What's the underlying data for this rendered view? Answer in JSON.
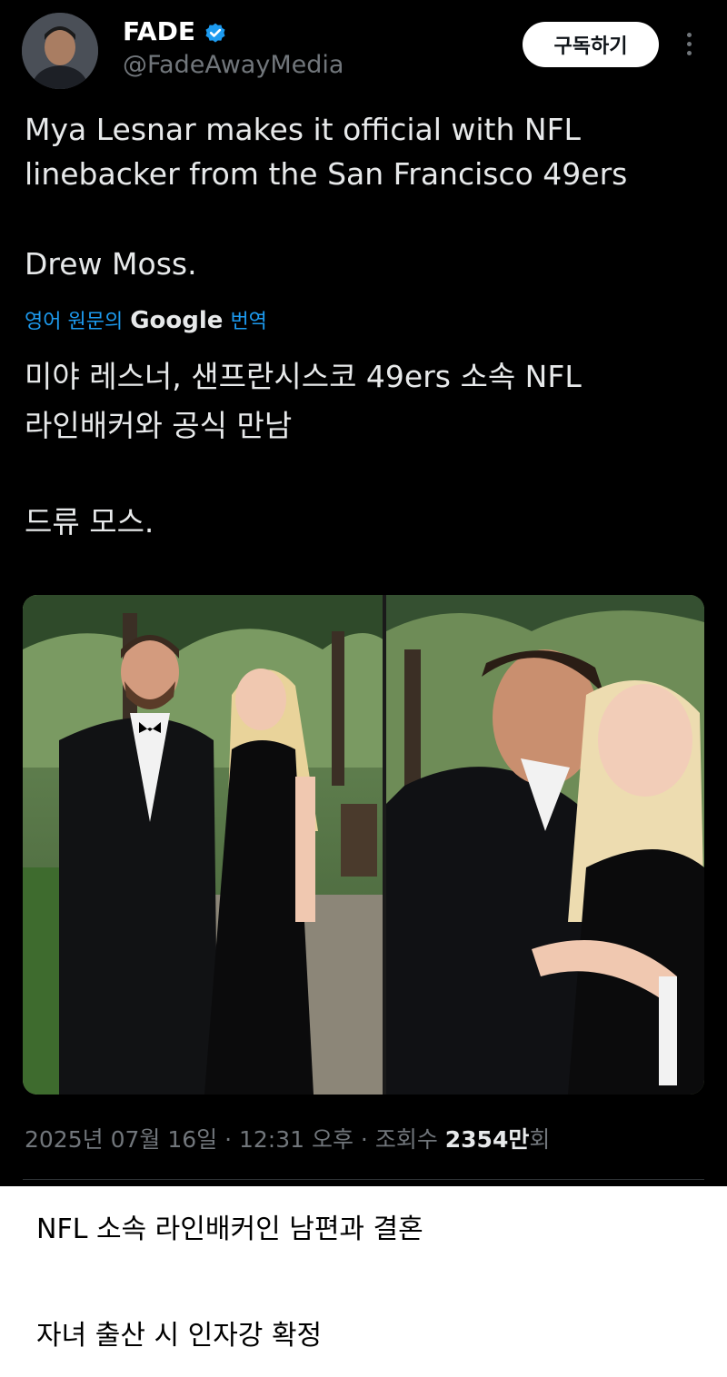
{
  "tweet": {
    "author_name": "FADE",
    "handle": "@FadeAwayMedia",
    "subscribe_label": "구독하기",
    "text_line1": "Mya Lesnar makes it official with NFL",
    "text_line2": "linebacker from the San Francisco 49ers",
    "text_line3": "Drew Moss.",
    "translate_prefix": "영어 원문의",
    "translate_brand": "Google",
    "translate_suffix": "번역",
    "translated_line1": "미야 레스너, 샌프란시스코 49ers 소속 NFL",
    "translated_line2": "라인배커와 공식 만남",
    "translated_line3": "드류 모스.",
    "meta_date": "2025년 07월 16일 · 12:31 오후 · 조회수 ",
    "meta_views": "2354만",
    "meta_views_suffix": "회"
  },
  "captions": {
    "line1": "NFL 소속 라인배커인 남편과 결혼",
    "line2": "자녀 출산 시 인자강 확정"
  },
  "colors": {
    "background": "#000000",
    "link": "#1d9bf0",
    "muted": "#71767b",
    "verified": "#1d9bf0"
  },
  "icons": [
    "verified-badge-icon",
    "more-dots-icon"
  ]
}
